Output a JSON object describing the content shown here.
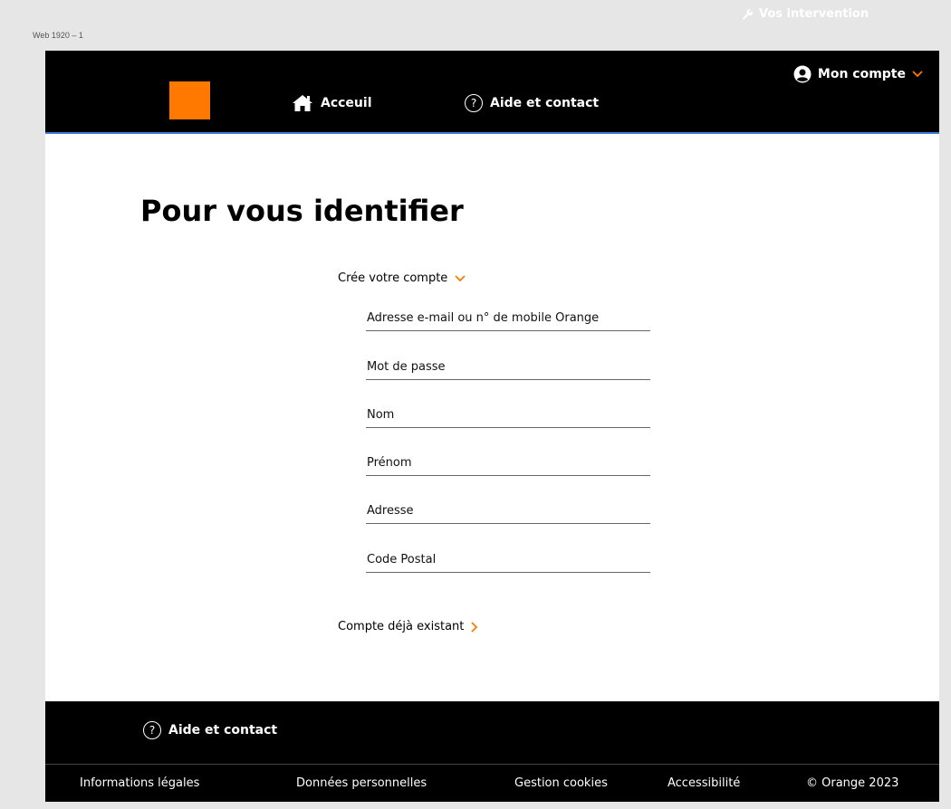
{
  "artboard_label": "Web 1920 – 1",
  "top_float": {
    "label": "Vos intervention"
  },
  "header": {
    "nav": [
      {
        "label": "Acceuil",
        "icon": "home-icon"
      },
      {
        "label": "Aide et contact",
        "icon": "help-circle-icon"
      }
    ],
    "account_label": "Mon compte"
  },
  "main": {
    "title": "Pour vous identifier",
    "create_label": "Crée votre compte",
    "existing_label": "Compte déjà existant",
    "fields": [
      {
        "placeholder": "Adresse e-mail ou n° de mobile Orange",
        "value": ""
      },
      {
        "placeholder": "Mot de passe",
        "value": ""
      },
      {
        "placeholder": "Nom",
        "value": ""
      },
      {
        "placeholder": "Prénom",
        "value": ""
      },
      {
        "placeholder": "Adresse",
        "value": ""
      },
      {
        "placeholder": "Code Postal",
        "value": ""
      }
    ]
  },
  "footer": {
    "help_label": "Aide et contact",
    "links": [
      "Informations légales",
      "Données personnelles",
      "Gestion cookies",
      "Accessibilité",
      "© Orange 2023"
    ]
  },
  "colors": {
    "brand": "#ff7900",
    "header_bg": "#000000",
    "page_bg": "#ffffff"
  }
}
